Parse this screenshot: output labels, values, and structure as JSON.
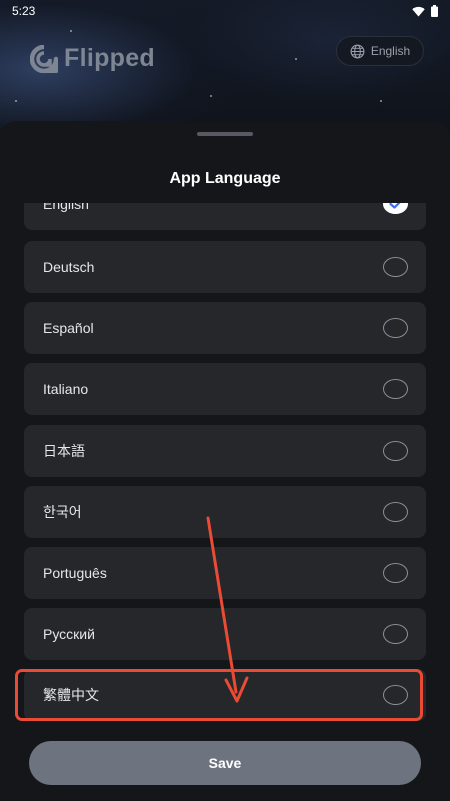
{
  "status_bar": {
    "time": "5:23"
  },
  "header": {
    "logo_text": "Flipped",
    "language_button": "English"
  },
  "sheet": {
    "title": "App Language",
    "items": [
      {
        "label": "English",
        "selected": true
      },
      {
        "label": "Deutsch",
        "selected": false
      },
      {
        "label": "Español",
        "selected": false
      },
      {
        "label": "Italiano",
        "selected": false
      },
      {
        "label": "日本語",
        "selected": false
      },
      {
        "label": "한국어",
        "selected": false
      },
      {
        "label": "Português",
        "selected": false
      },
      {
        "label": "Русский",
        "selected": false
      },
      {
        "label": "繁體中文",
        "selected": false
      }
    ],
    "save_label": "Save"
  },
  "colors": {
    "annotation": "#e94b34",
    "check_accent": "#3b73e6",
    "save_button": "#6d7480"
  }
}
